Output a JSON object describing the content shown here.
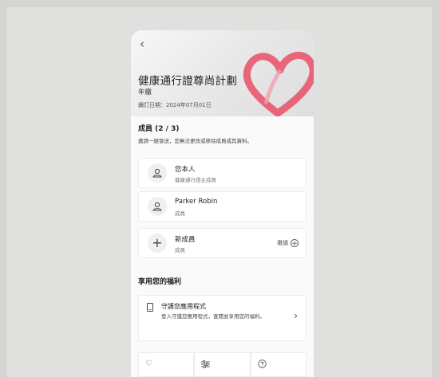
{
  "header": {
    "back_icon": "chevron-left-icon",
    "title": "健康通行證尊尚計劃",
    "subtitle": "年繳",
    "renewal": "續訂日期：2024年07月01日"
  },
  "members": {
    "title": "成員 (2 / 3)",
    "note": "邀請一經發送，您無法更改或移除成員或其資料。",
    "items": [
      {
        "name": "您本人",
        "role": "健康通行證主成員",
        "icon": "person-icon"
      },
      {
        "name": "Parker Robin",
        "role": "成員",
        "icon": "person-icon"
      },
      {
        "name": "新成員",
        "role": "成員",
        "icon": "plus-icon",
        "action": "邀請"
      }
    ]
  },
  "benefits": {
    "title": "享用您的福利",
    "card": {
      "icon": "phone-icon",
      "title": "守護您應用程式",
      "desc": "登入守護您應用程式，查閱並享用您的福利。",
      "arrow": "chevron-right-icon"
    },
    "tiles": [
      {
        "icon": "heart-outline-icon"
      },
      {
        "icon": "sliders-icon"
      },
      {
        "icon": "help-circle-icon"
      }
    ]
  },
  "colors": {
    "accent": "#e8576e",
    "background": "#d4d4d2"
  }
}
